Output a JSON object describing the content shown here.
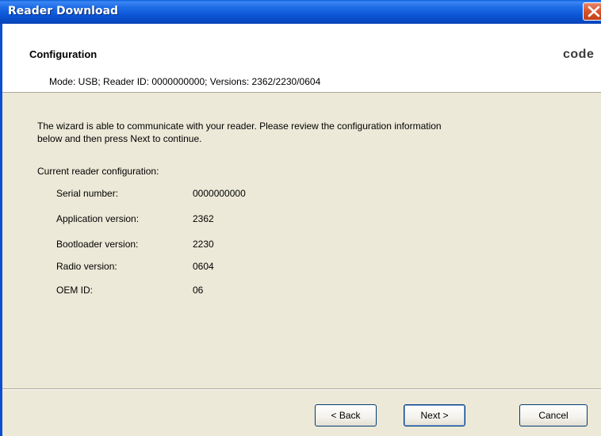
{
  "window": {
    "title": "Reader Download"
  },
  "header": {
    "title": "Configuration",
    "brand": "code",
    "mode_line": "Mode: USB; Reader ID: 0000000000; Versions: 2362/2230/0604"
  },
  "body": {
    "intro_line1": "The wizard is able to communicate with your reader.  Please review the configuration information",
    "intro_line2": "below and then press Next to continue.",
    "config_heading": "Current reader configuration:",
    "config": [
      {
        "label": "Serial number:",
        "value": "0000000000"
      },
      {
        "label": "Application version:",
        "value": "2362"
      },
      {
        "label": "Bootloader version:",
        "value": "2230"
      },
      {
        "label": "Radio version:",
        "value": "0604"
      },
      {
        "label": "OEM ID:",
        "value": "06"
      }
    ]
  },
  "buttons": {
    "back": "< Back",
    "next": "Next >",
    "cancel": "Cancel"
  },
  "colors": {
    "titlebar": "#0b55d6",
    "dialog_bg": "#ece9d8",
    "close_button": "#d8532c"
  },
  "icons": {
    "close": "close-x-icon"
  }
}
